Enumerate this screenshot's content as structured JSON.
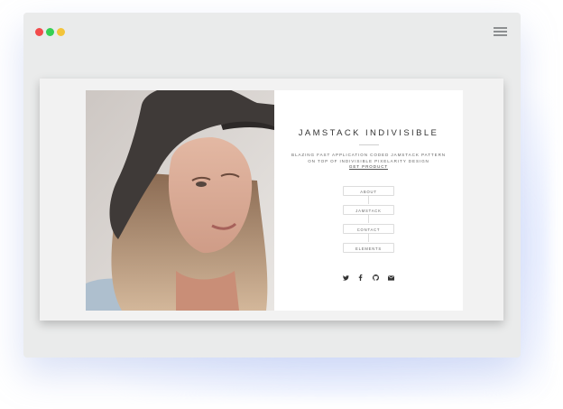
{
  "site": {
    "title": "JAMSTACK INDIVISIBLE",
    "tagline_line1": "BLAZING FAST APPLICATION CODED JAMSTACK PATTERN",
    "tagline_line2": "ON TOP OF INDIVISIBLE PIXELARITY DESIGN",
    "cta_label": "GET PRODUCT"
  },
  "nav": {
    "items": [
      {
        "label": "ABOUT"
      },
      {
        "label": "JAMSTACK"
      },
      {
        "label": "CONTACT"
      },
      {
        "label": "ELEMENTS"
      }
    ]
  },
  "social": [
    "twitter-icon",
    "facebook-icon",
    "github-icon",
    "email-icon"
  ],
  "colors": {
    "close": "#f24b4b",
    "maximize": "#37cf54",
    "minimize": "#f3c43a",
    "browser_frame": "#eaebeb",
    "page_background": "#f2f2f2",
    "card_background": "#ffffff",
    "text": "#333333"
  }
}
